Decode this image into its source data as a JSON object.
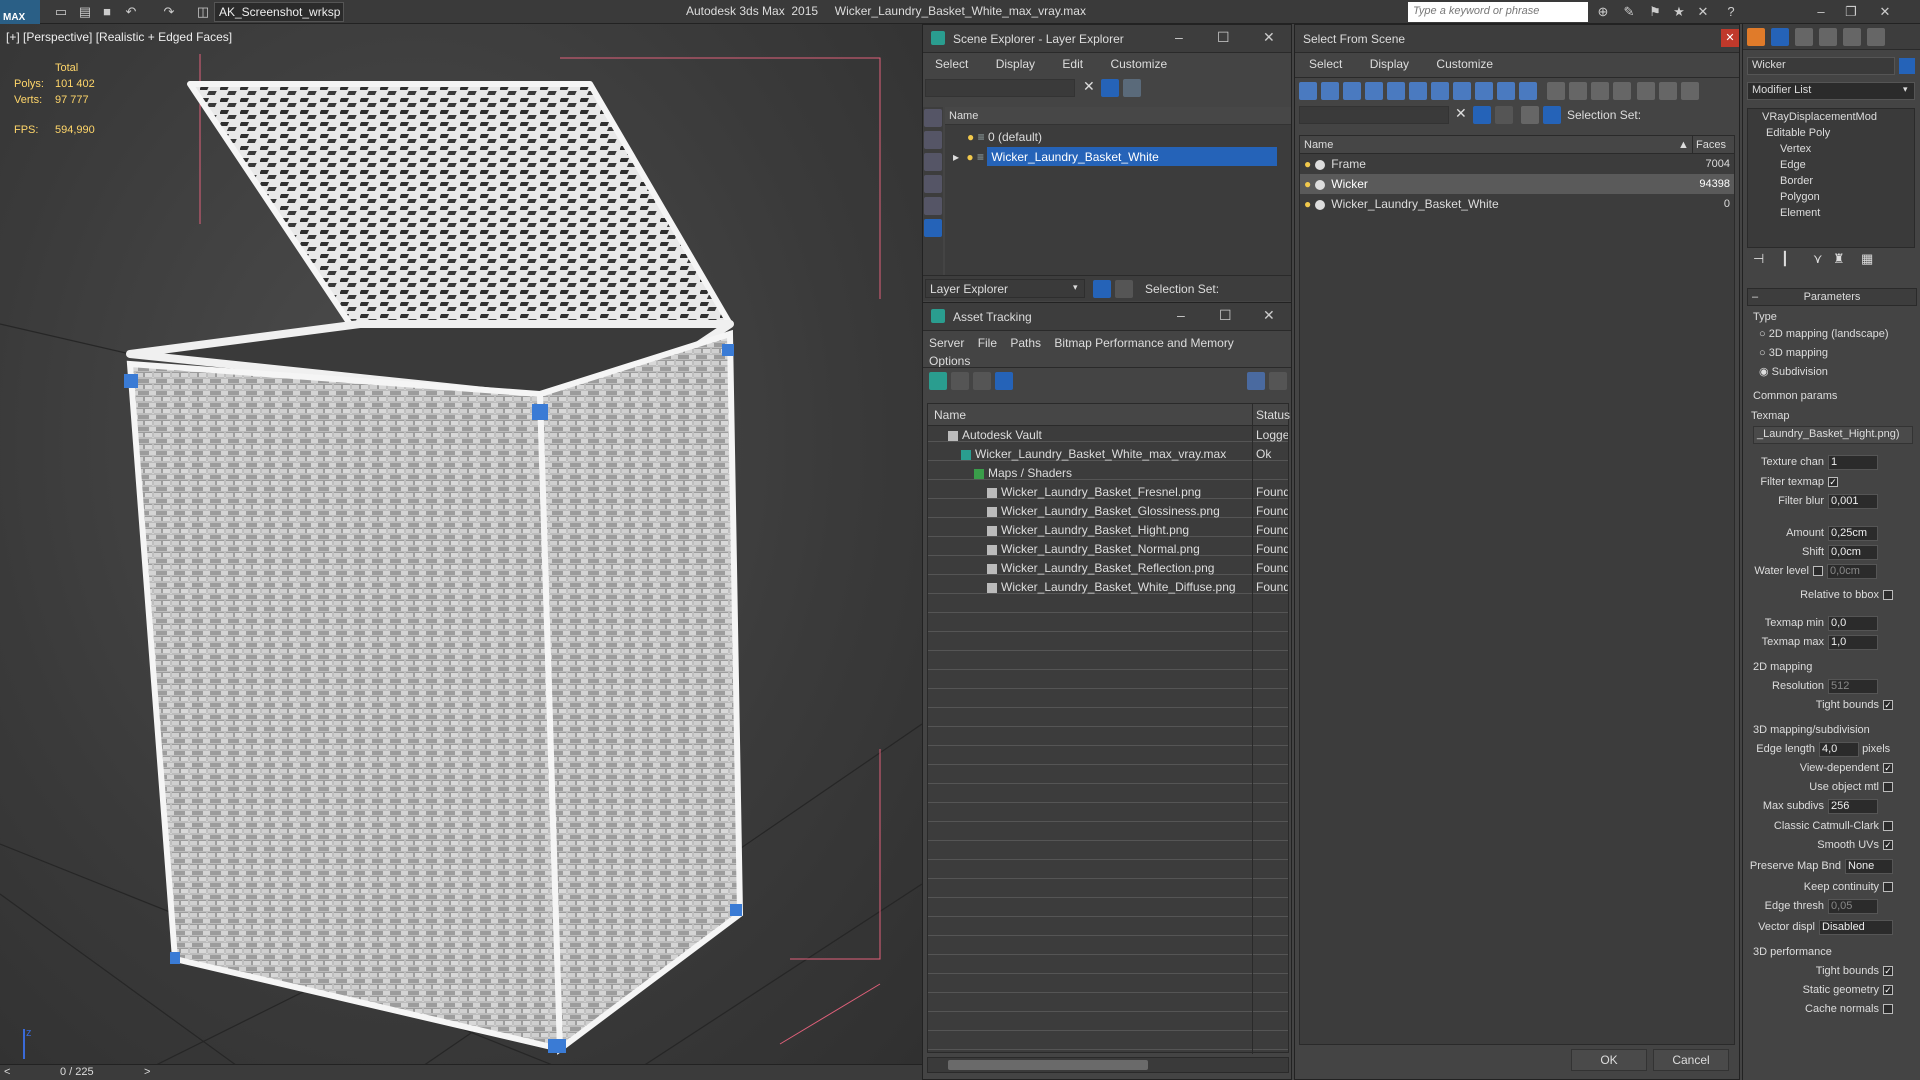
{
  "titlebar": {
    "workspace": "AK_Screenshot_wrksp",
    "app_title": "Autodesk 3ds Max  2015     Wicker_Laundry_Basket_White_max_vray.max",
    "search_placeholder": "Type a keyword or phrase",
    "logo": "MAX"
  },
  "viewport": {
    "label": "[+] [Perspective] [Realistic + Edged Faces]",
    "stats": {
      "total_label": "Total",
      "polys_label": "Polys:",
      "polys": "101 402",
      "verts_label": "Verts:",
      "verts": "97 777",
      "fps_label": "FPS:",
      "fps": "594,990"
    }
  },
  "timeline": {
    "frame": "0 / 225",
    "prev": "<",
    "next": ">"
  },
  "scene_explorer": {
    "title": "Scene Explorer - Layer Explorer",
    "menu": [
      "Select",
      "Display",
      "Edit",
      "Customize"
    ],
    "column_name": "Name",
    "layers": [
      {
        "name": "0 (default)",
        "selected": false
      },
      {
        "name": "Wicker_Laundry_Basket_White",
        "selected": true
      }
    ],
    "footer_dropdown": "Layer Explorer",
    "selection_set_label": "Selection Set:"
  },
  "asset_tracking": {
    "title": "Asset Tracking",
    "menu": [
      "Server",
      "File",
      "Paths",
      "Bitmap Performance and Memory"
    ],
    "menu2": "Options",
    "col_name": "Name",
    "col_status": "Status",
    "rows": [
      {
        "name": "Autodesk Vault",
        "status": "Logged",
        "indent": 0
      },
      {
        "name": "Wicker_Laundry_Basket_White_max_vray.max",
        "status": "Ok",
        "indent": 1
      },
      {
        "name": "Maps / Shaders",
        "status": "",
        "indent": 2
      },
      {
        "name": "Wicker_Laundry_Basket_Fresnel.png",
        "status": "Found",
        "indent": 3
      },
      {
        "name": "Wicker_Laundry_Basket_Glossiness.png",
        "status": "Found",
        "indent": 3
      },
      {
        "name": "Wicker_Laundry_Basket_Hight.png",
        "status": "Found",
        "indent": 3
      },
      {
        "name": "Wicker_Laundry_Basket_Normal.png",
        "status": "Found",
        "indent": 3
      },
      {
        "name": "Wicker_Laundry_Basket_Reflection.png",
        "status": "Found",
        "indent": 3
      },
      {
        "name": "Wicker_Laundry_Basket_White_Diffuse.png",
        "status": "Found",
        "indent": 3
      }
    ]
  },
  "select_from_scene": {
    "title": "Select From Scene",
    "menu": [
      "Select",
      "Display",
      "Customize"
    ],
    "selection_set_label": "Selection Set:",
    "col_name": "Name",
    "col_faces": "Faces",
    "objects": [
      {
        "name": "Frame",
        "faces": "7004",
        "selected": false
      },
      {
        "name": "Wicker",
        "faces": "94398",
        "selected": true
      },
      {
        "name": "Wicker_Laundry_Basket_White",
        "faces": "0",
        "selected": false
      }
    ],
    "ok": "OK",
    "cancel": "Cancel"
  },
  "command_panel": {
    "object_name": "Wicker",
    "modifier_list": "Modifier List",
    "stack": [
      {
        "name": "VRayDisplacementMod",
        "indent": 0
      },
      {
        "name": "Editable Poly",
        "indent": 0
      },
      {
        "name": "Vertex",
        "indent": 1
      },
      {
        "name": "Edge",
        "indent": 1
      },
      {
        "name": "Border",
        "indent": 1
      },
      {
        "name": "Polygon",
        "indent": 1
      },
      {
        "name": "Element",
        "indent": 1
      }
    ],
    "rollout_title": "Parameters",
    "type_label": "Type",
    "type_options": [
      "2D mapping (landscape)",
      "3D mapping",
      "Subdivision"
    ],
    "type_selected": 2,
    "common_params": "Common params",
    "texmap_label": "Texmap",
    "texmap_value": "_Laundry_Basket_Hight.png)",
    "texture_chan_label": "Texture chan",
    "texture_chan": "1",
    "filter_texmap_label": "Filter texmap",
    "filter_blur_label": "Filter blur",
    "filter_blur": "0,001",
    "amount_label": "Amount",
    "amount": "0,25cm",
    "shift_label": "Shift",
    "shift": "0,0cm",
    "water_level_label": "Water level",
    "water_level": "0,0cm",
    "relative_bbox_label": "Relative to bbox",
    "texmap_min_label": "Texmap min",
    "texmap_min": "0,0",
    "texmap_max_label": "Texmap max",
    "texmap_max": "1,0",
    "mapping2d_label": "2D mapping",
    "resolution_label": "Resolution",
    "resolution": "512",
    "tight_bounds_label": "Tight bounds",
    "mapping3d_label": "3D mapping/subdivision",
    "edge_length_label": "Edge length",
    "edge_length": "4,0",
    "pixels_label": "pixels",
    "view_dependent_label": "View-dependent",
    "use_object_mtl_label": "Use object mtl",
    "max_subdivs_label": "Max subdivs",
    "max_subdivs": "256",
    "catmull_label": "Classic Catmull-Clark",
    "smooth_uvs_label": "Smooth UVs",
    "preserve_map_label": "Preserve Map Bnd",
    "preserve_map": "None",
    "keep_continuity_label": "Keep continuity",
    "edge_thresh_label": "Edge thresh",
    "edge_thresh": "0,05",
    "vector_displ_label": "Vector displ",
    "vector_displ": "Disabled",
    "perf_label": "3D performance",
    "perf_tight_bounds_label": "Tight bounds",
    "static_geometry_label": "Static geometry",
    "cache_normals_label": "Cache normals"
  },
  "colors": {
    "accent_blue": "#2563b8",
    "selected_row": "#5a5a5a",
    "stat_yellow": "#ffd66a"
  }
}
